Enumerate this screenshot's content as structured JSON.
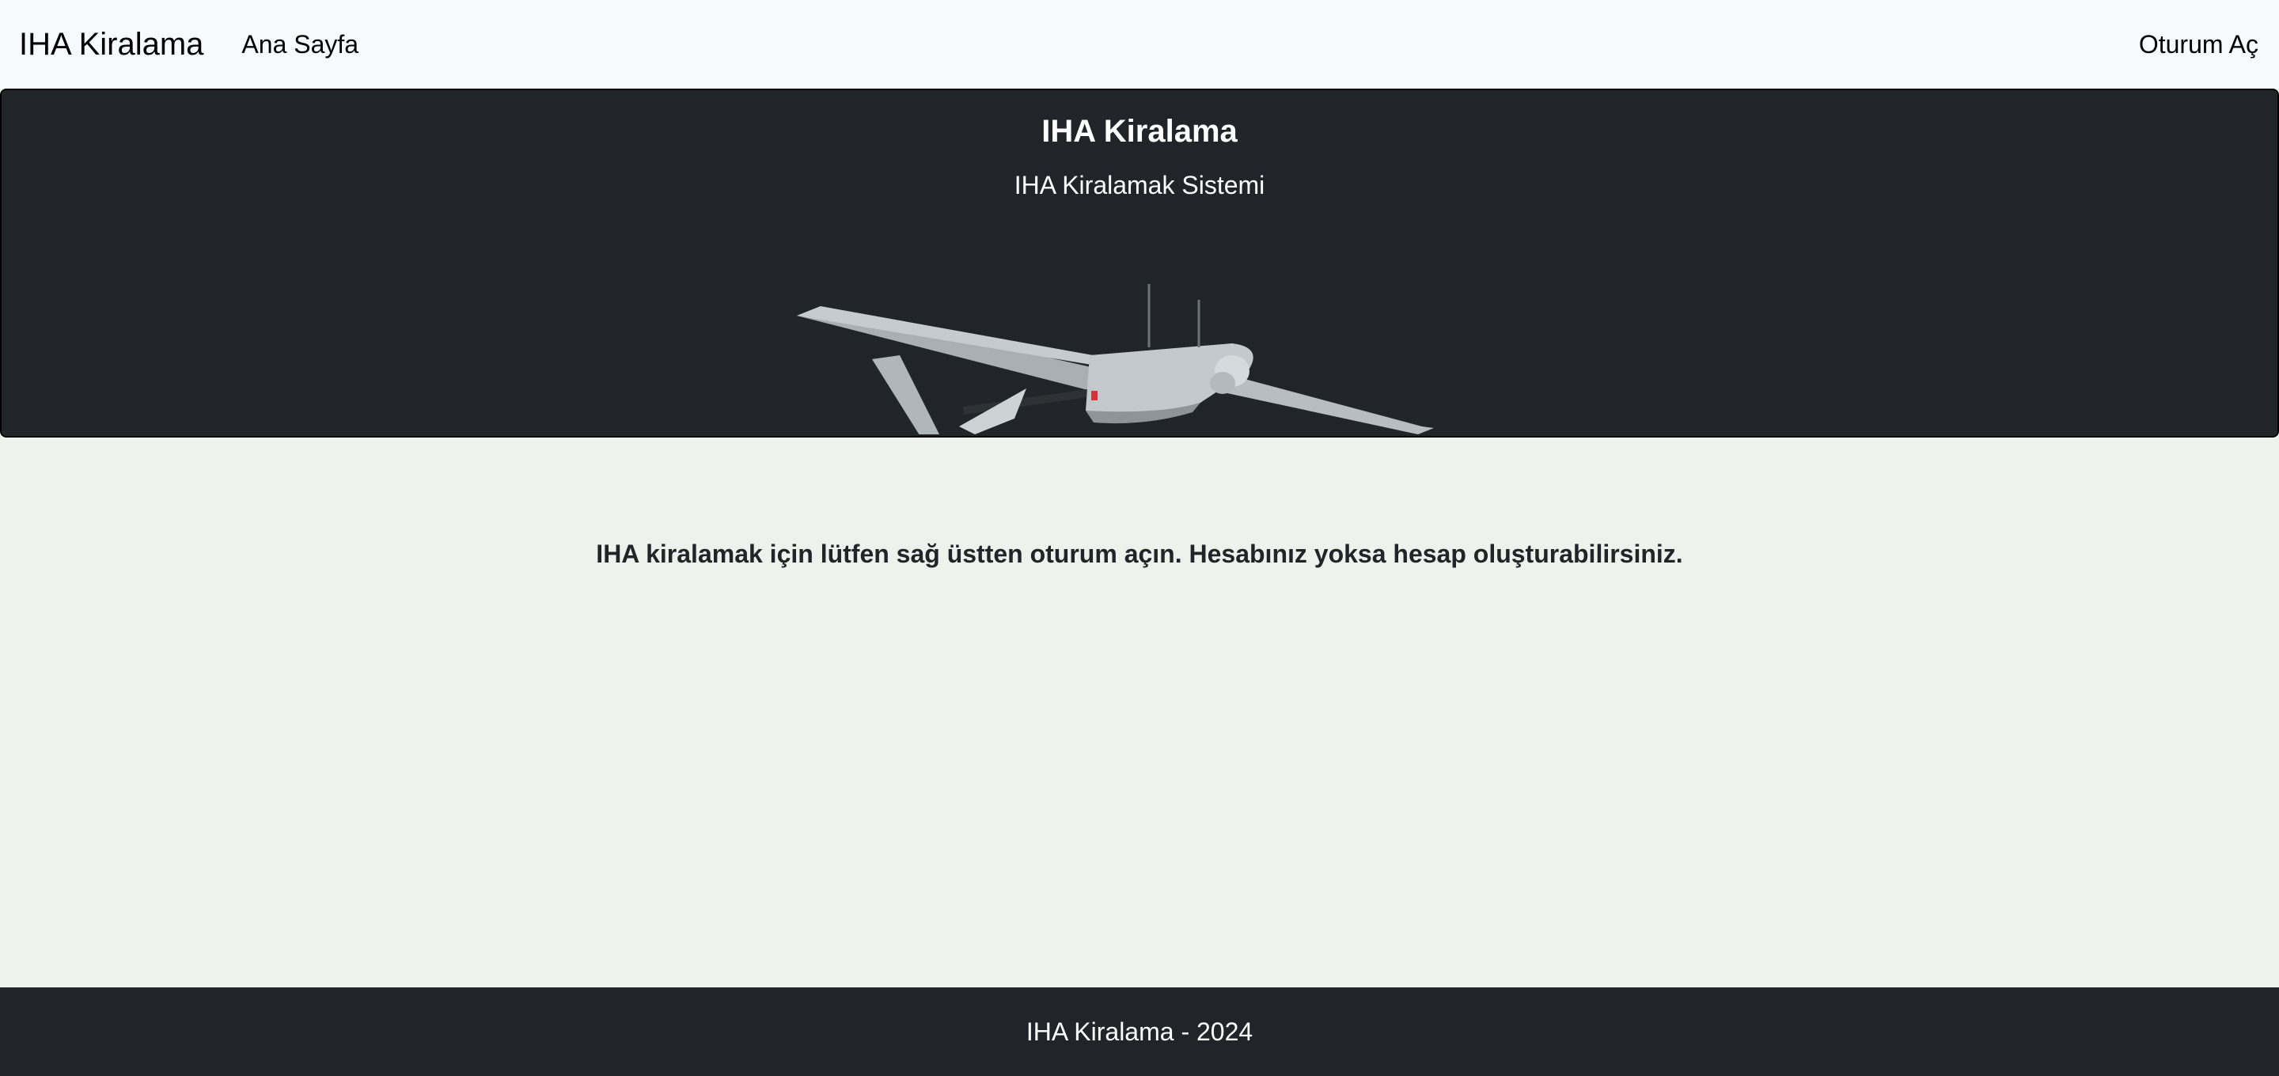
{
  "navbar": {
    "brand": "IHA Kiralama",
    "links": [
      {
        "label": "Ana Sayfa"
      }
    ],
    "login_label": "Oturum Aç"
  },
  "hero": {
    "title": "IHA Kiralama",
    "subtitle": "IHA Kiralamak Sistemi",
    "image": "drone-illustration"
  },
  "main": {
    "message": "IHA kiralamak için lütfen sağ üstten oturum açın. Hesabınız yoksa hesap oluşturabilirsiniz."
  },
  "footer": {
    "text": "IHA Kiralama - 2024"
  },
  "colors": {
    "navbar_bg": "#f8f9fa",
    "hero_bg": "#212529",
    "page_bg": "#edf2ed",
    "footer_bg": "#212529"
  }
}
